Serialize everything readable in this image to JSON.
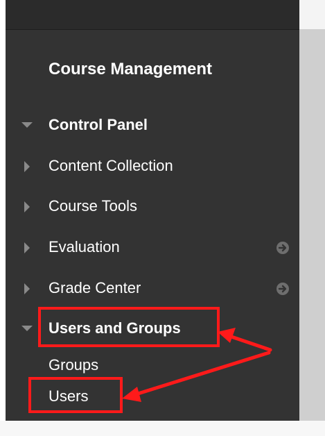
{
  "panel": {
    "heading": "Course Management",
    "control_panel": "Control Panel",
    "items": [
      {
        "label": "Content Collection"
      },
      {
        "label": "Course Tools"
      },
      {
        "label": "Evaluation"
      },
      {
        "label": "Grade Center"
      }
    ],
    "users_and_groups": "Users and Groups",
    "sub_items": [
      {
        "label": "Groups"
      },
      {
        "label": "Users"
      }
    ]
  },
  "colors": {
    "sidebar_bg": "#333333",
    "annotation": "#ff1a1a"
  },
  "icons": {
    "expanded": "triangle-down-icon",
    "collapsed": "triangle-right-icon",
    "go": "arrow-circle-icon"
  }
}
